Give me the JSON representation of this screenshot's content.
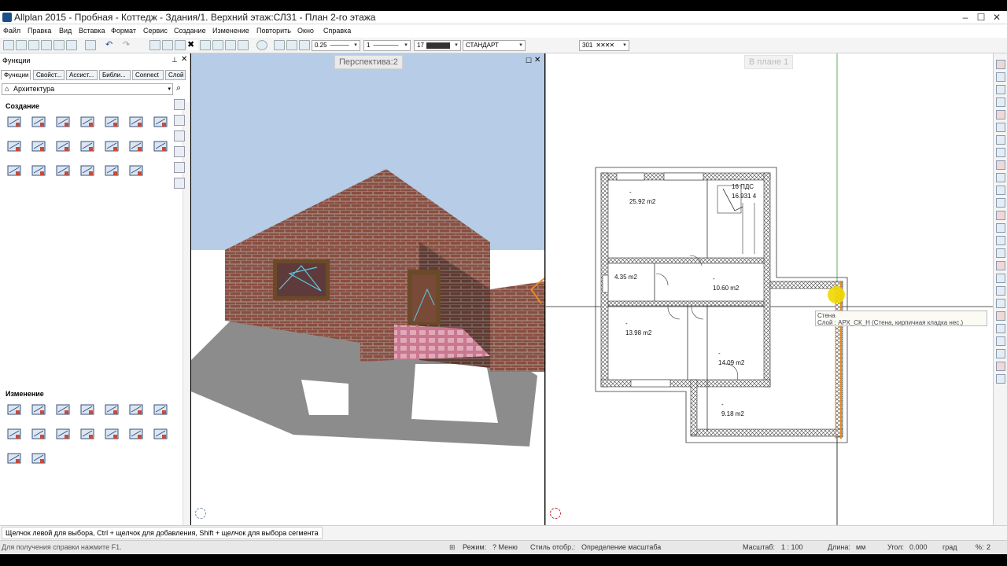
{
  "window": {
    "title": "Allplan 2015 - Пробная - Коттедж - Здания/1. Верхний этаж:СЛ31 - План 2-го этажа",
    "controls": [
      "–",
      "☐",
      "✕"
    ]
  },
  "menu": [
    "Файл",
    "Правка",
    "Вид",
    "Вставка",
    "Формат",
    "Сервис",
    "Создание",
    "Изменение",
    "Повторить",
    "Окно",
    "Справка"
  ],
  "toolbar": {
    "pen_thickness": "0.25",
    "line_type": "1",
    "color": "17",
    "layer": "СТАНДАРТ",
    "hatch": "301"
  },
  "left_panel": {
    "title": "Функции",
    "tabs": [
      "Функции",
      "Свойст...",
      "Ассист...",
      "Библи...",
      "Connect",
      "Слой"
    ],
    "category": "Архитектура",
    "section_create": "Создание",
    "section_modify": "Изменение",
    "create_icons_row1": [
      "wall-icon",
      "slab-icon",
      "roof-icon",
      "column-icon",
      "arch-icon",
      "panel-icon",
      "cube-icon"
    ],
    "create_icons_row2": [
      "window-icon",
      "door-icon",
      "stair-icon",
      "text-abc-icon",
      "number-123-icon",
      "grid-icon",
      "text-abc-frame-icon"
    ],
    "create_icons_row3": [
      "sheet-icon",
      "page-icon",
      "opening-icon",
      "niche-icon",
      "recess-icon",
      "scissors-icon"
    ],
    "modify_icons_row1": [
      "pick-icon",
      "paint-icon",
      "abc-edit-icon",
      "number-edit-icon",
      "replace-icon",
      "eraser-icon",
      "abc-change-icon"
    ],
    "modify_icons_row2": [
      "stretch-icon",
      "align-icon",
      "join-icon",
      "trim-icon",
      "split-icon",
      "mirror-icon",
      "offset-icon"
    ],
    "modify_icons_row3": [
      "copy-icon",
      "move-icon"
    ]
  },
  "views": {
    "perspective_title": "Перспектива:2",
    "plan_title": "В плане 1"
  },
  "plan": {
    "rooms": [
      {
        "label": "-",
        "area": "25.92 m2"
      },
      {
        "label": "-",
        "area": "4.35 m2"
      },
      {
        "label": "-",
        "area": "10.60 m2"
      },
      {
        "label": "-",
        "area": "13.98 m2"
      },
      {
        "label": "-",
        "area": "14.09 m2"
      },
      {
        "label": "-",
        "area": "9.18 m2"
      }
    ],
    "stair_label": "16 ПДС",
    "stair_label2": "16.931 4",
    "tooltip_line1": "Стена",
    "tooltip_line2": "Слой : АРХ_СК_Н (Стена, кирпичная кладка нес.)"
  },
  "status": {
    "hint": "Щелчок левой для выбора, Ctrl + щелчок для добавления, Shift + щелчок для выбора сегмента",
    "help": "Для получения справки нажмите F1.",
    "mode_label": "Режим:",
    "mode_value": "? Меню",
    "style_label": "Стиль отобр.:",
    "style_value": "Определение масштаба",
    "scale_label": "Масштаб:",
    "scale_value": "1 : 100",
    "length_label": "Длина:",
    "length_value": "мм",
    "angle_label": "Угол:",
    "angle_value": "0.000",
    "angle_unit": "град",
    "percent_label": "%:",
    "percent_value": "2"
  },
  "colors": {
    "sky": "#b7cce6",
    "brick": "#8a4e40",
    "tooltip_bg": "#fbfbf4",
    "snap_marker": "#f0d800",
    "orange_line": "#e68a1e"
  }
}
